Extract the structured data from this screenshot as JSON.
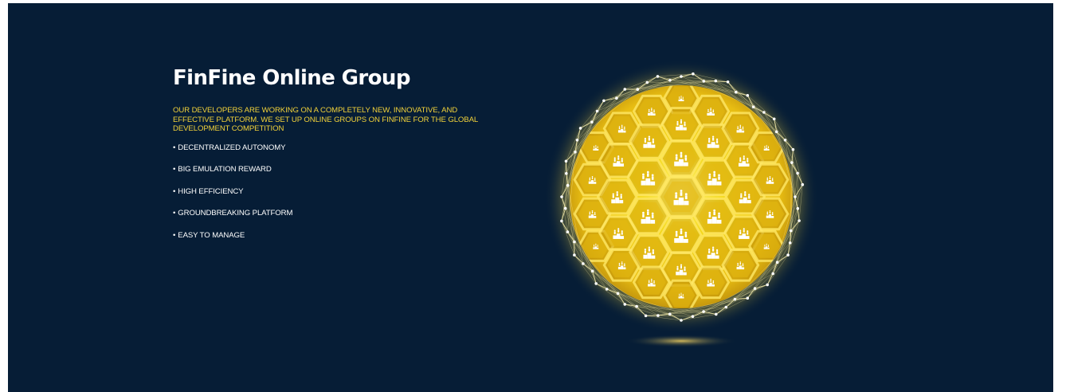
{
  "hero": {
    "title": "FinFine Online Group",
    "intro": "OUR DEVELOPERS ARE WORKING ON A COMPLETELY NEW, INNOVATIVE, AND EFFECTIVE PLATFORM. WE SET UP ONLINE GROUPS ON FINFINE FOR THE GLOBAL DEVELOPMENT COMPETITION",
    "bullet": "•",
    "features": [
      "DECENTRALIZED AUTONOMY",
      "BIG EMULATION REWARD",
      "HIGH EFFICIENCY",
      "GROUNDBREAKING PLATFORM",
      "EASY TO MANAGE"
    ]
  },
  "illustration": {
    "name": "golden-hexagon-globe",
    "icon": "podium-people-icon"
  },
  "colors": {
    "background": "#061d36",
    "title": "#ffffff",
    "intro": "#f2d23a",
    "feature": "#ffffff",
    "globe": "#f4d81c"
  }
}
